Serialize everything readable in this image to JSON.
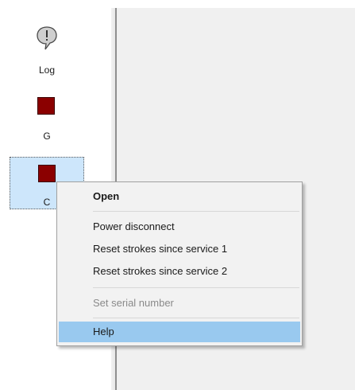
{
  "sidebar": {
    "devices": [
      {
        "label": "Log",
        "icon": "speech-bubble-exclamation-icon"
      },
      {
        "label": "G",
        "icon": "status-square-icon",
        "status_color": "#8b0000"
      },
      {
        "label": "C",
        "icon": "status-square-icon",
        "status_color": "#8b0000",
        "selected": true
      }
    ]
  },
  "context_menu": {
    "items": [
      {
        "label": "Open",
        "style": "bold"
      },
      {
        "label": "Power disconnect"
      },
      {
        "label": "Reset strokes since service 1"
      },
      {
        "label": "Reset strokes since service 2"
      },
      {
        "label": "Set serial number",
        "disabled": true
      },
      {
        "label": "Help",
        "highlighted": true
      }
    ]
  },
  "colors": {
    "status_red": "#8b0000",
    "selection_bg": "#cde6fb",
    "menu_highlight": "#99c9ef",
    "main_area_bg": "#f0f0f0"
  }
}
